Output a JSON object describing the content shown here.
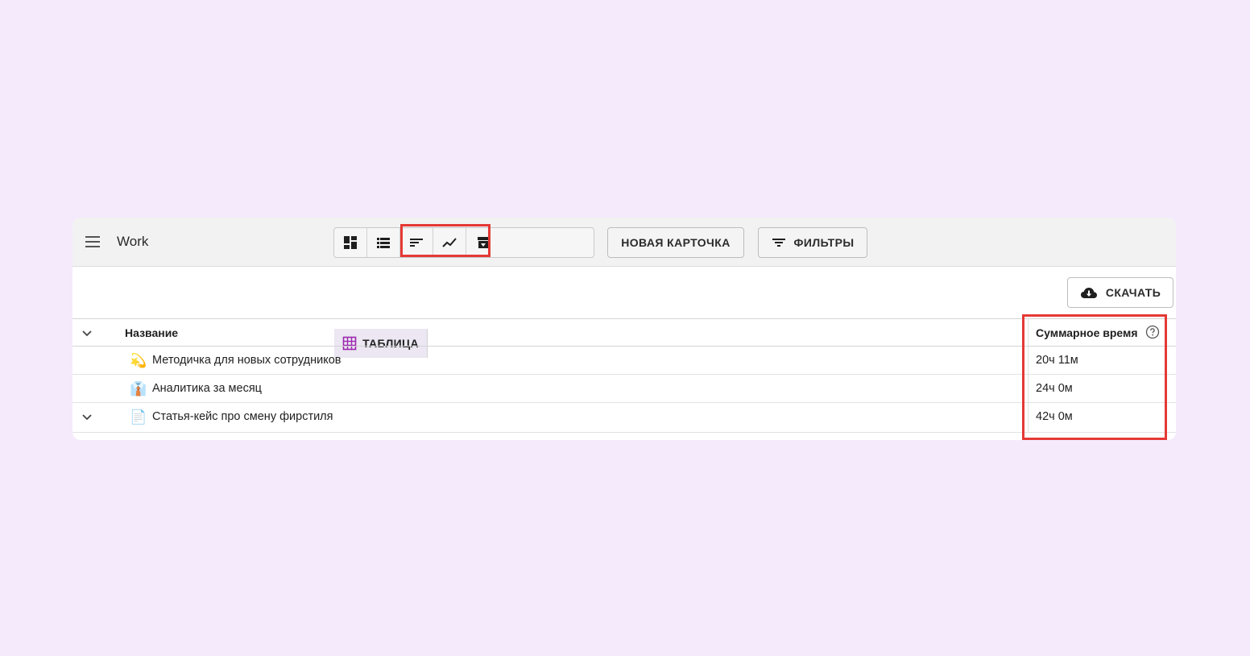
{
  "header": {
    "menu_icon": "hamburger-menu-icon",
    "title": "Work"
  },
  "views": {
    "items": [
      {
        "icon": "board-view-icon"
      },
      {
        "icon": "list-view-icon"
      },
      {
        "icon": "table-grid-icon",
        "label": "ТАБЛИЦА",
        "active": true
      },
      {
        "icon": "sort-icon"
      },
      {
        "icon": "trend-chart-icon"
      },
      {
        "icon": "archive-icon"
      }
    ]
  },
  "actions": {
    "new_card_label": "НОВАЯ КАРТОЧКА",
    "filters_label": "ФИЛЬТРЫ",
    "filters_icon": "filter-icon",
    "download_label": "СКАЧАТЬ",
    "download_icon": "cloud-download-icon"
  },
  "table": {
    "columns": [
      "Название",
      "Суммарное время"
    ],
    "rows": [
      {
        "emoji": "💫",
        "name": "Методичка для новых сотрудников",
        "time": "20ч 11м",
        "expandable": false
      },
      {
        "emoji": "👔",
        "name": "Аналитика за месяц",
        "time": "24ч 0м",
        "expandable": false
      },
      {
        "emoji": "📄",
        "name": "Статья-кейс про смену фирстиля",
        "time": "42ч 0м",
        "expandable": true
      }
    ]
  },
  "colors": {
    "page_background": "#f4eafc",
    "highlight": "#e53935",
    "active_icon": "#9c27b0"
  }
}
